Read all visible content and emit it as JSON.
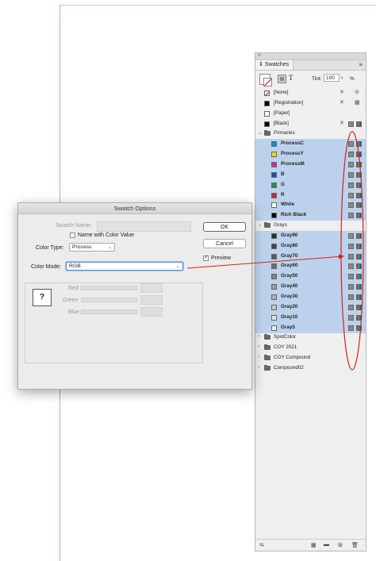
{
  "panel": {
    "tab_label": "Swatches",
    "tint_label": "Tint:",
    "tint_value": "100",
    "tint_unit": "%",
    "t_button": "T",
    "specials": [
      "[None]",
      "[Registration]",
      "[Paper]",
      "[Black]"
    ],
    "groups": [
      {
        "name": "Primaries",
        "swatches": [
          {
            "name": "ProcessC",
            "color": "#1a8ad1"
          },
          {
            "name": "ProcessY",
            "color": "#f5d31b"
          },
          {
            "name": "ProcessM",
            "color": "#d92a8b"
          },
          {
            "name": "B",
            "color": "#1f4fa8"
          },
          {
            "name": "G",
            "color": "#2e8a4a"
          },
          {
            "name": "R",
            "color": "#cc2a2a"
          },
          {
            "name": "White",
            "color": "#ffffff"
          },
          {
            "name": "Rich Black",
            "color": "#000000"
          }
        ]
      },
      {
        "name": "Grays",
        "swatches": [
          {
            "name": "Gray90",
            "color": "#2b2b2b"
          },
          {
            "name": "Gray80",
            "color": "#444444"
          },
          {
            "name": "Gray70",
            "color": "#595959"
          },
          {
            "name": "Gray60",
            "color": "#6e6e6e"
          },
          {
            "name": "Gray50",
            "color": "#828282"
          },
          {
            "name": "Gray40",
            "color": "#999999"
          },
          {
            "name": "Gray30",
            "color": "#adadad"
          },
          {
            "name": "Gray20",
            "color": "#c8c8c8"
          },
          {
            "name": "Gray10",
            "color": "#e2e2e2"
          },
          {
            "name": "Gray5",
            "color": "#f2f2f2"
          }
        ]
      }
    ],
    "collapsed_groups": [
      "SpotColor",
      "COY 2021",
      "COY Compound",
      "Compound02"
    ]
  },
  "dialog": {
    "title": "Swatch Options",
    "swatch_name_label": "Swatch Name:",
    "name_with_color_value": "Name with Color Value",
    "color_type_label": "Color Type:",
    "color_type_value": "Process",
    "color_mode_label": "Color Mode:",
    "color_mode_value": "RGB",
    "ok_label": "OK",
    "cancel_label": "Cancel",
    "preview_label": "Preview",
    "preview_checked": true,
    "swatch_placeholder": "?",
    "channels": [
      "Red",
      "Green",
      "Blue"
    ]
  },
  "annotation_color": "#d42020"
}
